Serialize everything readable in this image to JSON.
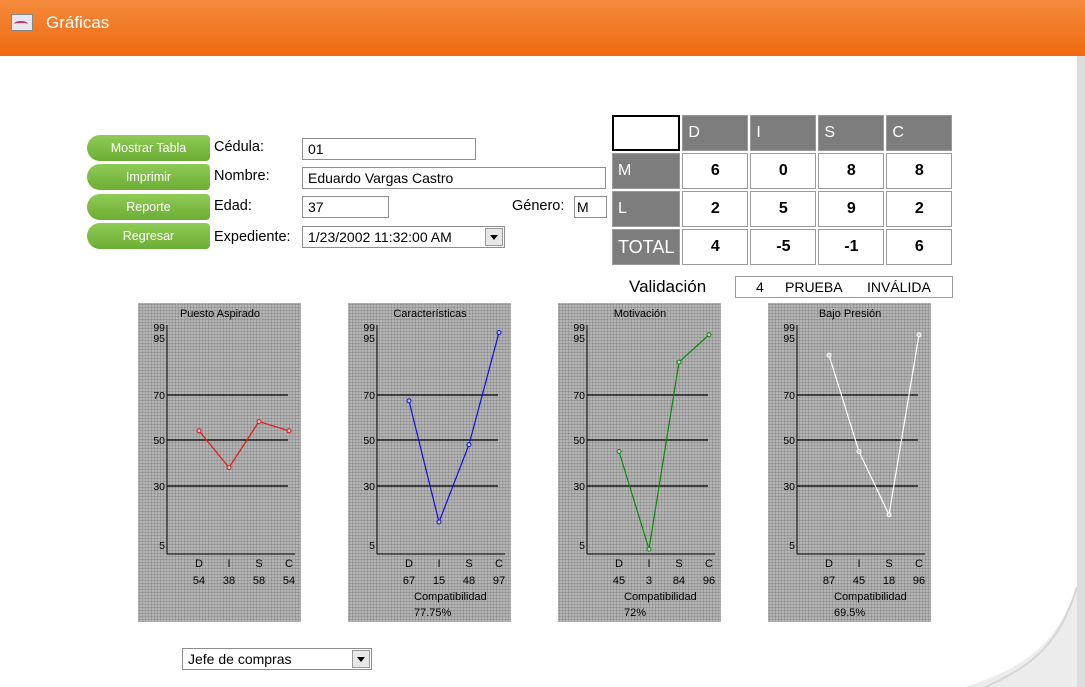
{
  "window": {
    "title": "Gráficas",
    "icon": "chart-app-icon"
  },
  "buttons": {
    "show_table": "Mostrar Tabla",
    "print": "Imprimir",
    "report": "Reporte",
    "back": "Regresar"
  },
  "form": {
    "cedula_label": "Cédula:",
    "cedula_value": "01",
    "nombre_label": "Nombre:",
    "nombre_value": "Eduardo Vargas Castro",
    "edad_label": "Edad:",
    "edad_value": "37",
    "genero_label": "Género:",
    "genero_value": "M",
    "expediente_label": "Expediente:",
    "expediente_value": "1/23/2002 11:32:00 AM"
  },
  "disc_table": {
    "headers": [
      "D",
      "I",
      "S",
      "C"
    ],
    "rows": [
      {
        "label": "M",
        "values": [
          "6",
          "0",
          "8",
          "8"
        ]
      },
      {
        "label": "L",
        "values": [
          "2",
          "5",
          "9",
          "2"
        ]
      },
      {
        "label": "TOTAL",
        "values": [
          "4",
          "-5",
          "-1",
          "6"
        ]
      }
    ]
  },
  "validation": {
    "label": "Validación",
    "number": "4",
    "status_word1": "PRUEBA",
    "status_word2": "INVÁLIDA"
  },
  "position_select": {
    "value": "Jefe de compras"
  },
  "chart_data": [
    {
      "type": "line",
      "title": "Puesto Aspirado",
      "categories": [
        "D",
        "I",
        "S",
        "C"
      ],
      "values": [
        54,
        38,
        58,
        54
      ],
      "color": "#e01818",
      "y_ticks": [
        "99",
        "95",
        "70",
        "50",
        "30",
        "5"
      ],
      "compatibility_label": "",
      "compatibility_value": ""
    },
    {
      "type": "line",
      "title": "Características",
      "categories": [
        "D",
        "I",
        "S",
        "C"
      ],
      "values": [
        67,
        15,
        48,
        97
      ],
      "color": "#1010d8",
      "y_ticks": [
        "99",
        "95",
        "70",
        "50",
        "30",
        "5"
      ],
      "compatibility_label": "Compatibilidad",
      "compatibility_value": "77.75%"
    },
    {
      "type": "line",
      "title": "Motivación",
      "categories": [
        "D",
        "I",
        "S",
        "C"
      ],
      "values": [
        45,
        3,
        84,
        96
      ],
      "color": "#0a8a0a",
      "y_ticks": [
        "99",
        "95",
        "70",
        "50",
        "30",
        "5"
      ],
      "compatibility_label": "Compatibilidad",
      "compatibility_value": "72%"
    },
    {
      "type": "line",
      "title": "Bajo Presión",
      "categories": [
        "D",
        "I",
        "S",
        "C"
      ],
      "values": [
        87,
        45,
        18,
        96
      ],
      "color": "#ffffff",
      "y_ticks": [
        "99",
        "95",
        "70",
        "50",
        "30",
        "5"
      ],
      "compatibility_label": "Compatibilidad",
      "compatibility_value": "69.5%"
    }
  ]
}
